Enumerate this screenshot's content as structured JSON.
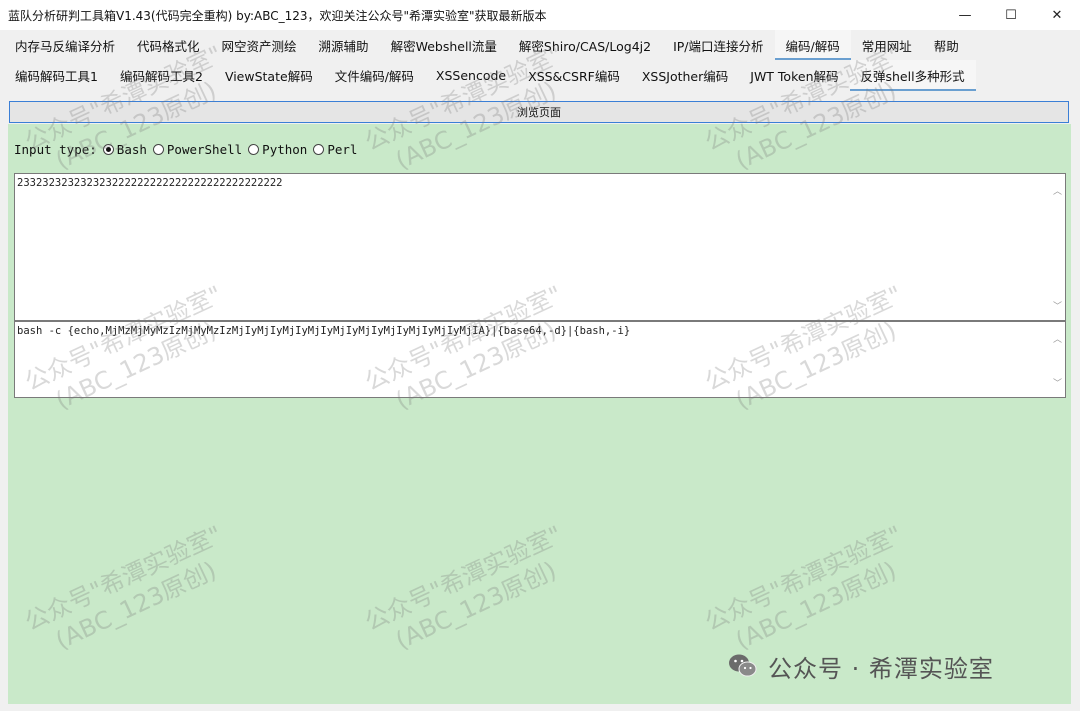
{
  "window": {
    "title": "蓝队分析研判工具箱V1.43(代码完全重构) by:ABC_123，欢迎关注公众号\"希潭实验室\"获取最新版本",
    "controls": {
      "minimize": "—",
      "maximize": "☐",
      "close": "✕"
    }
  },
  "main_tabs": [
    {
      "label": "内存马反编译分析"
    },
    {
      "label": "代码格式化"
    },
    {
      "label": "网空资产测绘"
    },
    {
      "label": "溯源辅助"
    },
    {
      "label": "解密Webshell流量"
    },
    {
      "label": "解密Shiro/CAS/Log4j2"
    },
    {
      "label": "IP/端口连接分析"
    },
    {
      "label": "编码/解码",
      "active": true
    },
    {
      "label": "常用网址"
    },
    {
      "label": "帮助"
    }
  ],
  "sub_tabs": [
    {
      "label": "编码解码工具1"
    },
    {
      "label": "编码解码工具2"
    },
    {
      "label": "ViewState解码"
    },
    {
      "label": "文件编码/解码"
    },
    {
      "label": "XSSencode"
    },
    {
      "label": "XSS&CSRF编码"
    },
    {
      "label": "XSSJother编码"
    },
    {
      "label": "JWT Token解码"
    },
    {
      "label": "反弹shell多种形式",
      "active": true
    }
  ],
  "browse_button": "浏览页面",
  "input_type": {
    "label": "Input type:",
    "options": [
      "Bash",
      "PowerShell",
      "Python",
      "Perl"
    ],
    "selected": "Bash"
  },
  "input_text": "233232323232323222222222222222222222222222",
  "output_text": "bash -c {echo,MjMzMjMyMzIzMjMyMzIzMjIyMjIyMjIyMjIyMjIyMjIyMjIyMjIyMjIyMjIA}|{base64,-d}|{bash,-i}",
  "watermark": {
    "line1": "公众号\"希潭实验室\"",
    "line2": "(ABC_123原创)"
  },
  "wechat_footer": {
    "icon": "wechat-icon",
    "text": "公众号 · 希潭实验室"
  },
  "colors": {
    "content_bg": "#c9e9c9",
    "active_tab_underline": "#6a9fd0",
    "button_border": "#3b7fd6"
  }
}
